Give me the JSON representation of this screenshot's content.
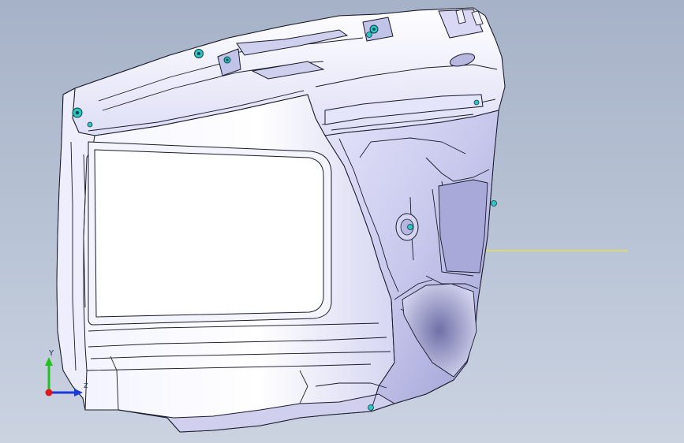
{
  "app": {
    "view": "cad-3d-viewport"
  },
  "colors": {
    "background_top": "#a6b2c7",
    "background_bottom": "#cbd3e1",
    "part_fill": "#e6e6fb",
    "part_edge": "#1a1a2e",
    "fastener": "#2ec4c4",
    "reference_line": "#e8e832",
    "triad_y": "#22c022",
    "triad_x": "#1a3ad8",
    "triad_origin": "#e01818"
  },
  "triad": {
    "y_label": "Y",
    "z_label": "Z"
  },
  "icons": {
    "fastener": "fastener-icon"
  }
}
